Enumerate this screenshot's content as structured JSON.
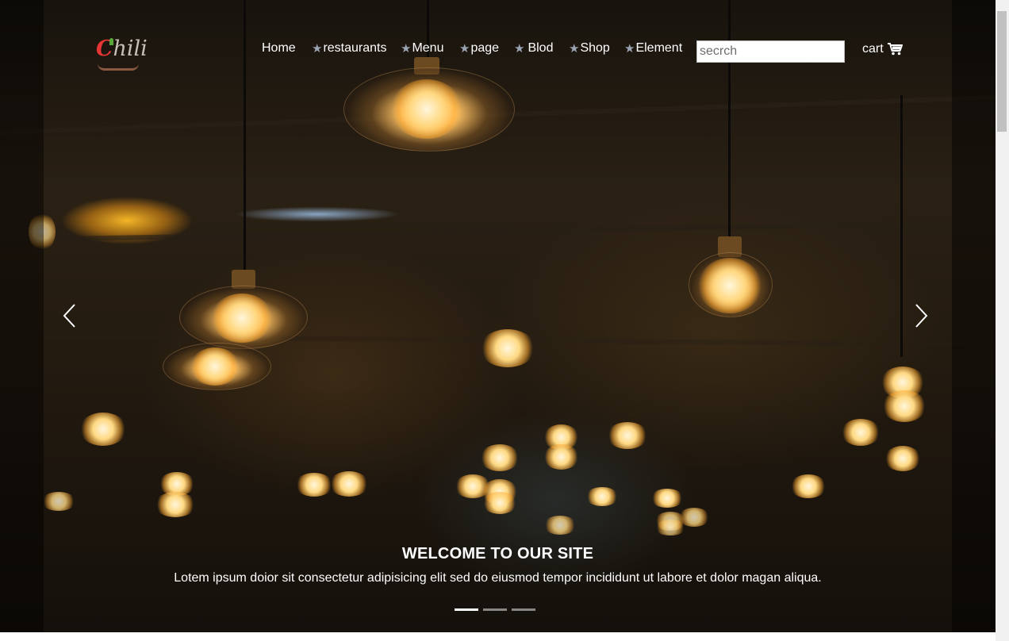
{
  "brand": {
    "logo_text": "chili",
    "logo_initial": "C",
    "logo_rest": "hili"
  },
  "nav": {
    "items": [
      {
        "label": "Home",
        "star": false
      },
      {
        "label": "restaurants",
        "star": true
      },
      {
        "label": "Menu",
        "star": true
      },
      {
        "label": "page",
        "star": true
      },
      {
        "label": "Blod",
        "star": true
      },
      {
        "label": "Shop",
        "star": true
      },
      {
        "label": "Element",
        "star": true
      }
    ],
    "star_glyph": "★"
  },
  "search": {
    "placeholder": "secrch",
    "value": ""
  },
  "cart": {
    "label": "cart",
    "icon": "cart-icon"
  },
  "carousel": {
    "prev_icon": "chevron-left-icon",
    "next_icon": "chevron-right-icon",
    "slide_count": 3,
    "active_index": 0,
    "caption_title": "WELCOME TO OUR SITE",
    "caption_text": "Lotem ipsum doior sit consectetur adipisicing elit sed do eiusmod tempor incididunt ut labore et dolor magan aliqua."
  },
  "colors": {
    "nav_text": "#ffffff",
    "star": "#9aa4b3",
    "logo_accent": "#e53535"
  }
}
